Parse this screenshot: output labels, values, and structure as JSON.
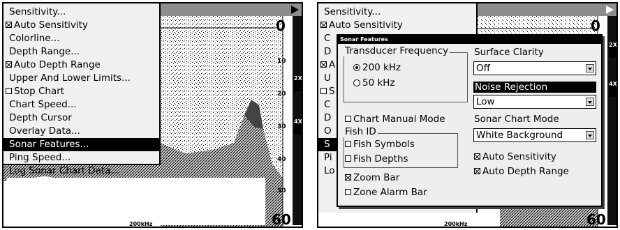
{
  "left_menu": {
    "items": [
      {
        "label": "Sensitivity...",
        "checkbox": null
      },
      {
        "label": "Auto Sensitivity",
        "checkbox": "checked"
      },
      {
        "label": "Colorline...",
        "checkbox": null
      },
      {
        "label": "Depth Range...",
        "checkbox": null
      },
      {
        "label": "Auto Depth Range",
        "checkbox": "checked"
      },
      {
        "label": "Upper And Lower Limits...",
        "checkbox": null
      },
      {
        "label": "Stop Chart",
        "checkbox": "unchecked"
      },
      {
        "label": "Chart Speed...",
        "checkbox": null
      },
      {
        "label": "Depth Cursor",
        "checkbox": null
      },
      {
        "label": "Overlay Data...",
        "checkbox": null
      },
      {
        "label": "Sonar Features...",
        "checkbox": null,
        "selected": true
      },
      {
        "label": "Ping Speed...",
        "checkbox": null
      },
      {
        "label": "Log Sonar Chart Data...",
        "checkbox": null
      }
    ]
  },
  "right_menu_partial": [
    "Sensitivity...",
    "Auto Sensitivity",
    "Colorline...",
    "Depth Range...",
    "Auto Depth Range",
    "Upper And Lower Limits...",
    "Stop Chart",
    "Chart Speed...",
    "Depth Cursor",
    "Overlay Data...",
    "Sonar Features...",
    "Ping Speed...",
    "Log Sonar Chart Data..."
  ],
  "right_menu_visible": [
    "Sensitivity...",
    "Auto Sensitivity",
    "C",
    "D",
    "A",
    "U",
    "S",
    "C",
    "D",
    "O",
    "S",
    "Pi",
    "Lo"
  ],
  "sonar_left": {
    "depths": [
      "0",
      "10",
      "20",
      "30",
      "40",
      "50",
      "60"
    ],
    "frequency": "200kHz",
    "zoom_labels": [
      "2X",
      "4X"
    ]
  },
  "sonar_right": {
    "depths": [
      "0",
      "60"
    ],
    "frequency": "200kHz",
    "zoom_labels": [
      "2X",
      "4X"
    ]
  },
  "dialog": {
    "title": "Sonar Features",
    "transducer_frequency": {
      "label": "Transducer Frequency",
      "options": [
        "200 kHz",
        "50 kHz"
      ],
      "selected": "200 kHz"
    },
    "surface_clarity": {
      "label": "Surface Clarity",
      "value": "Off"
    },
    "noise_rejection": {
      "label": "Noise Rejection",
      "value": "Low"
    },
    "chart_manual_mode": {
      "label": "Chart Manual Mode",
      "checked": false
    },
    "fish_id": {
      "label": "Fish ID",
      "fish_symbols": {
        "label": "Fish Symbols",
        "checked": false
      },
      "fish_depths": {
        "label": "Fish Depths",
        "checked": false
      }
    },
    "sonar_chart_mode": {
      "label": "Sonar Chart Mode",
      "value": "White Background"
    },
    "auto_sensitivity": {
      "label": "Auto Sensitivity",
      "checked": true
    },
    "auto_depth_range": {
      "label": "Auto Depth Range",
      "checked": true
    },
    "zoom_bar": {
      "label": "Zoom Bar",
      "checked": true
    },
    "zone_alarm_bar": {
      "label": "Zone Alarm Bar",
      "checked": false
    }
  },
  "colors": {
    "menu_bg": "#f0f0f0",
    "titlebar": "#8d8d8d",
    "selected_bg": "#000000",
    "selected_fg": "#ffffff"
  }
}
